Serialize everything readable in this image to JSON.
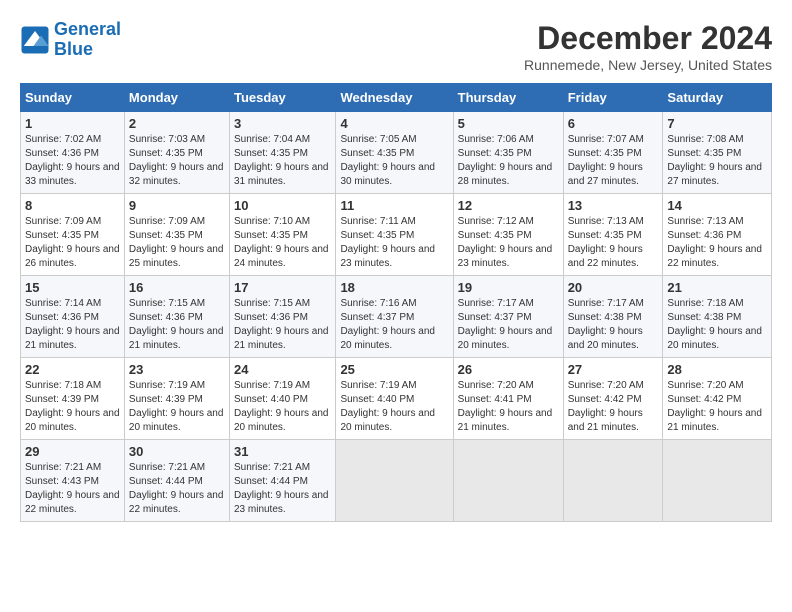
{
  "logo": {
    "line1": "General",
    "line2": "Blue"
  },
  "title": "December 2024",
  "subtitle": "Runnemede, New Jersey, United States",
  "days_of_week": [
    "Sunday",
    "Monday",
    "Tuesday",
    "Wednesday",
    "Thursday",
    "Friday",
    "Saturday"
  ],
  "weeks": [
    [
      {
        "num": "1",
        "sunrise": "7:02 AM",
        "sunset": "4:36 PM",
        "daylight": "9 hours and 33 minutes."
      },
      {
        "num": "2",
        "sunrise": "7:03 AM",
        "sunset": "4:35 PM",
        "daylight": "9 hours and 32 minutes."
      },
      {
        "num": "3",
        "sunrise": "7:04 AM",
        "sunset": "4:35 PM",
        "daylight": "9 hours and 31 minutes."
      },
      {
        "num": "4",
        "sunrise": "7:05 AM",
        "sunset": "4:35 PM",
        "daylight": "9 hours and 30 minutes."
      },
      {
        "num": "5",
        "sunrise": "7:06 AM",
        "sunset": "4:35 PM",
        "daylight": "9 hours and 28 minutes."
      },
      {
        "num": "6",
        "sunrise": "7:07 AM",
        "sunset": "4:35 PM",
        "daylight": "9 hours and 27 minutes."
      },
      {
        "num": "7",
        "sunrise": "7:08 AM",
        "sunset": "4:35 PM",
        "daylight": "9 hours and 27 minutes."
      }
    ],
    [
      {
        "num": "8",
        "sunrise": "7:09 AM",
        "sunset": "4:35 PM",
        "daylight": "9 hours and 26 minutes."
      },
      {
        "num": "9",
        "sunrise": "7:09 AM",
        "sunset": "4:35 PM",
        "daylight": "9 hours and 25 minutes."
      },
      {
        "num": "10",
        "sunrise": "7:10 AM",
        "sunset": "4:35 PM",
        "daylight": "9 hours and 24 minutes."
      },
      {
        "num": "11",
        "sunrise": "7:11 AM",
        "sunset": "4:35 PM",
        "daylight": "9 hours and 23 minutes."
      },
      {
        "num": "12",
        "sunrise": "7:12 AM",
        "sunset": "4:35 PM",
        "daylight": "9 hours and 23 minutes."
      },
      {
        "num": "13",
        "sunrise": "7:13 AM",
        "sunset": "4:35 PM",
        "daylight": "9 hours and 22 minutes."
      },
      {
        "num": "14",
        "sunrise": "7:13 AM",
        "sunset": "4:36 PM",
        "daylight": "9 hours and 22 minutes."
      }
    ],
    [
      {
        "num": "15",
        "sunrise": "7:14 AM",
        "sunset": "4:36 PM",
        "daylight": "9 hours and 21 minutes."
      },
      {
        "num": "16",
        "sunrise": "7:15 AM",
        "sunset": "4:36 PM",
        "daylight": "9 hours and 21 minutes."
      },
      {
        "num": "17",
        "sunrise": "7:15 AM",
        "sunset": "4:36 PM",
        "daylight": "9 hours and 21 minutes."
      },
      {
        "num": "18",
        "sunrise": "7:16 AM",
        "sunset": "4:37 PM",
        "daylight": "9 hours and 20 minutes."
      },
      {
        "num": "19",
        "sunrise": "7:17 AM",
        "sunset": "4:37 PM",
        "daylight": "9 hours and 20 minutes."
      },
      {
        "num": "20",
        "sunrise": "7:17 AM",
        "sunset": "4:38 PM",
        "daylight": "9 hours and 20 minutes."
      },
      {
        "num": "21",
        "sunrise": "7:18 AM",
        "sunset": "4:38 PM",
        "daylight": "9 hours and 20 minutes."
      }
    ],
    [
      {
        "num": "22",
        "sunrise": "7:18 AM",
        "sunset": "4:39 PM",
        "daylight": "9 hours and 20 minutes."
      },
      {
        "num": "23",
        "sunrise": "7:19 AM",
        "sunset": "4:39 PM",
        "daylight": "9 hours and 20 minutes."
      },
      {
        "num": "24",
        "sunrise": "7:19 AM",
        "sunset": "4:40 PM",
        "daylight": "9 hours and 20 minutes."
      },
      {
        "num": "25",
        "sunrise": "7:19 AM",
        "sunset": "4:40 PM",
        "daylight": "9 hours and 20 minutes."
      },
      {
        "num": "26",
        "sunrise": "7:20 AM",
        "sunset": "4:41 PM",
        "daylight": "9 hours and 21 minutes."
      },
      {
        "num": "27",
        "sunrise": "7:20 AM",
        "sunset": "4:42 PM",
        "daylight": "9 hours and 21 minutes."
      },
      {
        "num": "28",
        "sunrise": "7:20 AM",
        "sunset": "4:42 PM",
        "daylight": "9 hours and 21 minutes."
      }
    ],
    [
      {
        "num": "29",
        "sunrise": "7:21 AM",
        "sunset": "4:43 PM",
        "daylight": "9 hours and 22 minutes."
      },
      {
        "num": "30",
        "sunrise": "7:21 AM",
        "sunset": "4:44 PM",
        "daylight": "9 hours and 22 minutes."
      },
      {
        "num": "31",
        "sunrise": "7:21 AM",
        "sunset": "4:44 PM",
        "daylight": "9 hours and 23 minutes."
      },
      null,
      null,
      null,
      null
    ]
  ],
  "sunrise_label": "Sunrise:",
  "sunset_label": "Sunset:",
  "daylight_label": "Daylight:"
}
